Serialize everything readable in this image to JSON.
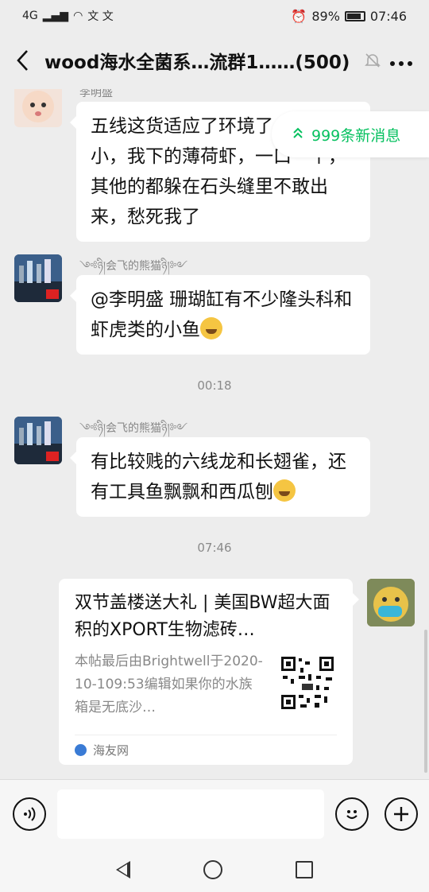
{
  "status_bar": {
    "network": "4G",
    "left_glyphs": "文 文",
    "battery_percent": "89%",
    "time": "07:46"
  },
  "header": {
    "back_icon": "chevron-left-icon",
    "title": "wood海水全菌系…流群1……(500)",
    "mute_icon": "bell-off-icon",
    "more_icon": "more-icon"
  },
  "new_messages": {
    "label": "999条新消息"
  },
  "messages": [
    {
      "nickname": "李明盛",
      "text": "五线这货适应了环境了，胆子小，我下的薄荷虾，一口一个，其他的都躲在石头缝里不敢出来，愁死我了"
    },
    {
      "nickname": "༺ཉི།会飞的熊猫ཉི།༻",
      "text": "@李明盛  珊瑚缸有不少隆头科和虾虎类的小鱼"
    },
    {
      "nickname": "༺ཉི།会飞的熊猫ཉི།༻",
      "text": "有比较贱的六线龙和长翅雀，还有工具鱼飘飘和西瓜刨"
    }
  ],
  "timestamps": [
    "00:18",
    "07:46"
  ],
  "link_card": {
    "title": "双节盖楼送大礼 | 美国BW超大面积的XPORT生物滤砖…",
    "description": "本帖最后由Brightwell于2020-10-109:53编辑如果你的水族箱是无底沙…",
    "source": "海友网"
  },
  "input_bar": {
    "voice_icon": "voice-icon",
    "emoji_icon": "emoji-icon",
    "plus_icon": "plus-icon",
    "placeholder": ""
  },
  "colors": {
    "accent": "#07c160",
    "background": "#ededed",
    "bubble": "#ffffff"
  }
}
